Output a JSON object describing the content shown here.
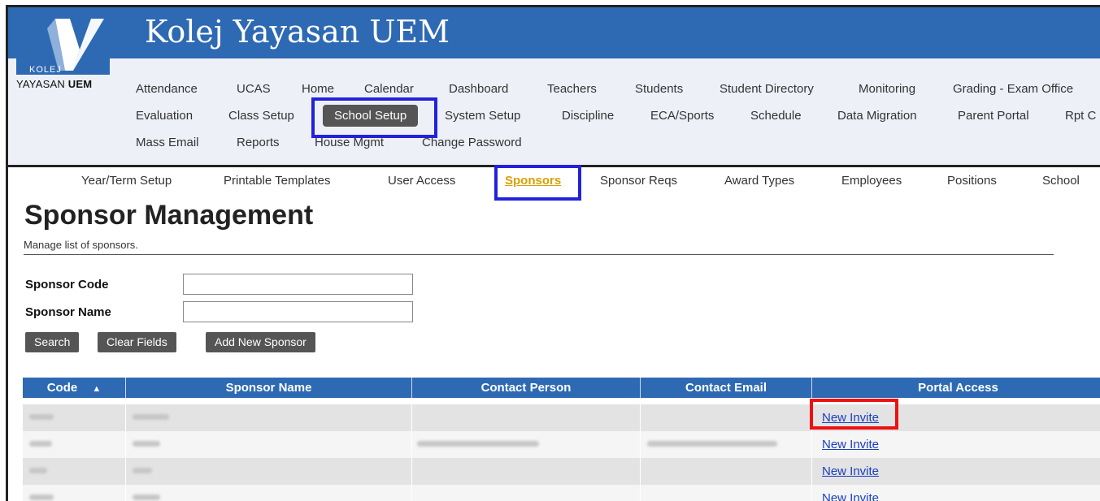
{
  "app": {
    "title": "Kolej Yayasan UEM",
    "logo_top": "KOLEJ",
    "logo_bottom_a": "YAYASAN",
    "logo_bottom_b": "UEM"
  },
  "top_nav": {
    "row1": [
      "Attendance",
      "UCAS",
      "Home",
      "Calendar",
      "Dashboard",
      "Teachers",
      "Students",
      "Student Directory",
      "Monitoring",
      "Grading - Exam Office"
    ],
    "row2": [
      "Evaluation",
      "Class Setup",
      "School Setup",
      "System Setup",
      "Discipline",
      "ECA/Sports",
      "Schedule",
      "Data Migration",
      "Parent Portal",
      "Rpt C"
    ],
    "row3": [
      "Mass Email",
      "Reports",
      "House Mgmt",
      "Change Password"
    ],
    "active": "School Setup"
  },
  "sub_nav": {
    "items": [
      "Year/Term Setup",
      "Printable Templates",
      "User Access",
      "Sponsors",
      "Sponsor Reqs",
      "Award Types",
      "Employees",
      "Positions",
      "School"
    ],
    "active": "Sponsors"
  },
  "page": {
    "title": "Sponsor Management",
    "subtitle": "Manage list of sponsors."
  },
  "form": {
    "code_label": "Sponsor Code",
    "name_label": "Sponsor Name",
    "code_value": "",
    "name_value": "",
    "search_label": "Search",
    "clear_label": "Clear Fields",
    "add_label": "Add New Sponsor"
  },
  "table": {
    "headers": [
      "Code",
      "Sponsor Name",
      "Contact Person",
      "Contact Email",
      "Portal Access"
    ],
    "sort_indicator": "▲",
    "rows": [
      {
        "portal": "New Invite"
      },
      {
        "portal": "New Invite"
      },
      {
        "portal": "New Invite"
      },
      {
        "portal": "New Invite"
      }
    ]
  },
  "colors": {
    "brand_blue": "#2e69b3",
    "highlight_blue": "#2222dd",
    "highlight_red": "#ee1111",
    "active_sub_nav": "#d9a000"
  }
}
